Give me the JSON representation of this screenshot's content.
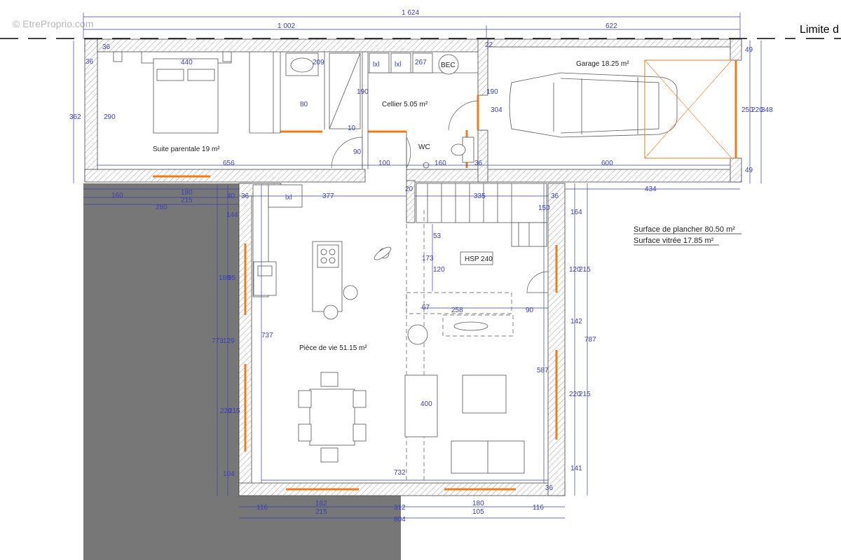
{
  "watermark": "© EtreProprio.com",
  "limit_label": "Limite d",
  "rooms": {
    "suite": "Suite parentale 19 m²",
    "cellier": "Cellier 5.05 m²",
    "garage": "Garage 18.25 m²",
    "wc": "WC",
    "piece_vie": "Pièce de vie 51.15 m²",
    "hsp": "HSP 240",
    "bec": "BEC"
  },
  "surfaces": {
    "plancher": "Surface de plancher 80.50 m²",
    "vitree": "Surface vitrée 17.85 m²"
  },
  "dims": {
    "total_width": "1 624",
    "house_width": "1 002",
    "garage_width": "622",
    "d36": "36",
    "d22": "22",
    "d440": "440",
    "d209": "209",
    "d267": "267",
    "d190a": "190",
    "d190b": "190",
    "d80": "80",
    "d10": "10",
    "d90a": "90",
    "d362": "362",
    "d290": "290",
    "d656": "656",
    "d100": "100",
    "d160a": "160",
    "d600": "600",
    "d304": "304",
    "d49a": "49",
    "d49b": "49",
    "d250": "250",
    "d220a": "220",
    "d348": "348",
    "d434": "434",
    "d160b": "160",
    "d180a": "180",
    "d215a": "215",
    "d280": "280",
    "d40": "40",
    "d377": "377",
    "d20": "20",
    "d335": "335",
    "d164": "164",
    "d144": "144",
    "d180b": "180",
    "d95": "95",
    "d773": "773",
    "d129": "129",
    "d220b": "220",
    "d215b": "215",
    "d104": "104",
    "d737": "737",
    "d53": "53",
    "d173": "173",
    "d120a": "120",
    "d150": "150",
    "d120b": "120",
    "d215c": "215",
    "d67": "67",
    "d258": "258",
    "d90b": "90",
    "d142": "142",
    "d787": "787",
    "d587": "587",
    "d400": "400",
    "d220c": "220",
    "d215d": "215",
    "d141": "141",
    "d732": "732",
    "d116a": "116",
    "d182": "182",
    "d215e": "215",
    "d312": "312",
    "d180c": "180",
    "d105": "105",
    "d116b": "116",
    "d804": "804",
    "kxl1": "lxl",
    "kxl2": "lxl",
    "kxl3": "lxl"
  },
  "colors": {
    "dimension": "#3a3fb5",
    "window": "#f07b1a",
    "neighbor": "#777777"
  }
}
